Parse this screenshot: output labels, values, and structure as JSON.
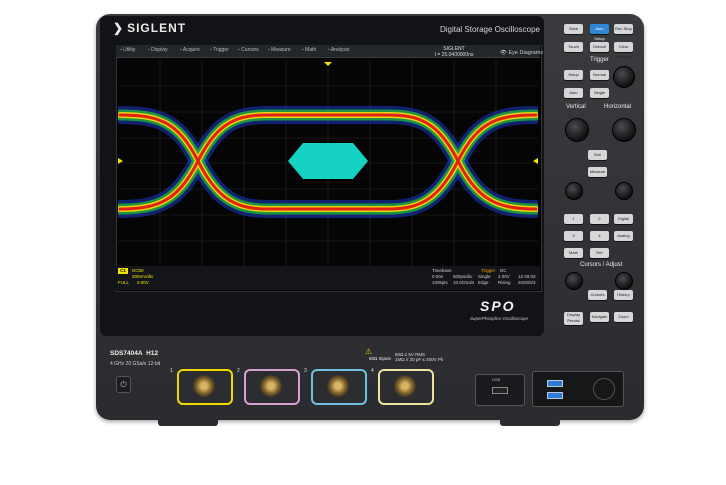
{
  "brand": "SIGLENT",
  "device_title": "Digital Storage Oscilloscope",
  "menu": [
    "Utility",
    "Display",
    "Acquire",
    "Trigger",
    "Cursors",
    "Measure",
    "Math",
    "Analysis"
  ],
  "ident": {
    "brand": "SIGLENT",
    "value": "t = 25.0400000ns"
  },
  "eye_button": "Eye Diagrams",
  "status": {
    "ch1_badge": "C1",
    "ch1_coupling": "DC50",
    "ch1_scale": "200mV/div",
    "ch1_offset": "0.00V",
    "ch1_mode": "FULL",
    "timebase_label": "Timebase",
    "timebase_delay": "0.00s",
    "timebase_scale": "500ps/div",
    "sample_rate": "100kpts",
    "sample_rate2": "10.0GSa/s",
    "trigger_label": "Trigger",
    "trigger_mode": "Single",
    "trigger_type": "Edge",
    "trigger_coupling": "DC",
    "trigger_level": "4.00V",
    "trigger_slope": "Rising",
    "time": "12:49:03",
    "date": "2020/6/3"
  },
  "spo": {
    "logo": "SPO",
    "subtitle": "SuperPhosphor Oscilloscope"
  },
  "model": {
    "name": "SDS7404A",
    "variant": "H12",
    "spec": "4 GHz  20 GSa/s 12-bit"
  },
  "input_warning": {
    "label": "50Ω Inputs",
    "spec_lines": [
      "50Ω ≤ 5V RMS",
      "1MΩ // 20 pF ≤ 400V Pk"
    ]
  },
  "channels": [
    {
      "num": "1",
      "color": "#f0d800"
    },
    {
      "num": "2",
      "color": "#d8a0d0"
    },
    {
      "num": "3",
      "color": "#6fc0e0"
    },
    {
      "num": "4",
      "color": "#f0e0a0"
    }
  ],
  "usb_label": "USB",
  "right_panel": {
    "top_buttons": [
      "Save",
      "Auto Setup",
      "Run Stop",
      "Touch",
      "Default",
      "Clear Sweeps",
      "Setup",
      "Normal",
      "Auto",
      "Single",
      "Roll",
      "Measure"
    ],
    "trigger_label": "Trigger",
    "vertical_label": "Vertical",
    "horizontal_label": "Horizontal",
    "cursors_label": "Cursors / Adjust",
    "channel_buttons": [
      "1",
      "2",
      "Digital",
      "3",
      "4",
      "Analog",
      "Math",
      "Ref"
    ],
    "bottom_buttons": [
      "Cursors",
      "History",
      "Display Persist",
      "Navigate",
      "Zoom"
    ]
  },
  "colors": {
    "eye_inner": "#16d2c4",
    "ch1": "#f0e400",
    "chassis": "#2d2e31"
  }
}
